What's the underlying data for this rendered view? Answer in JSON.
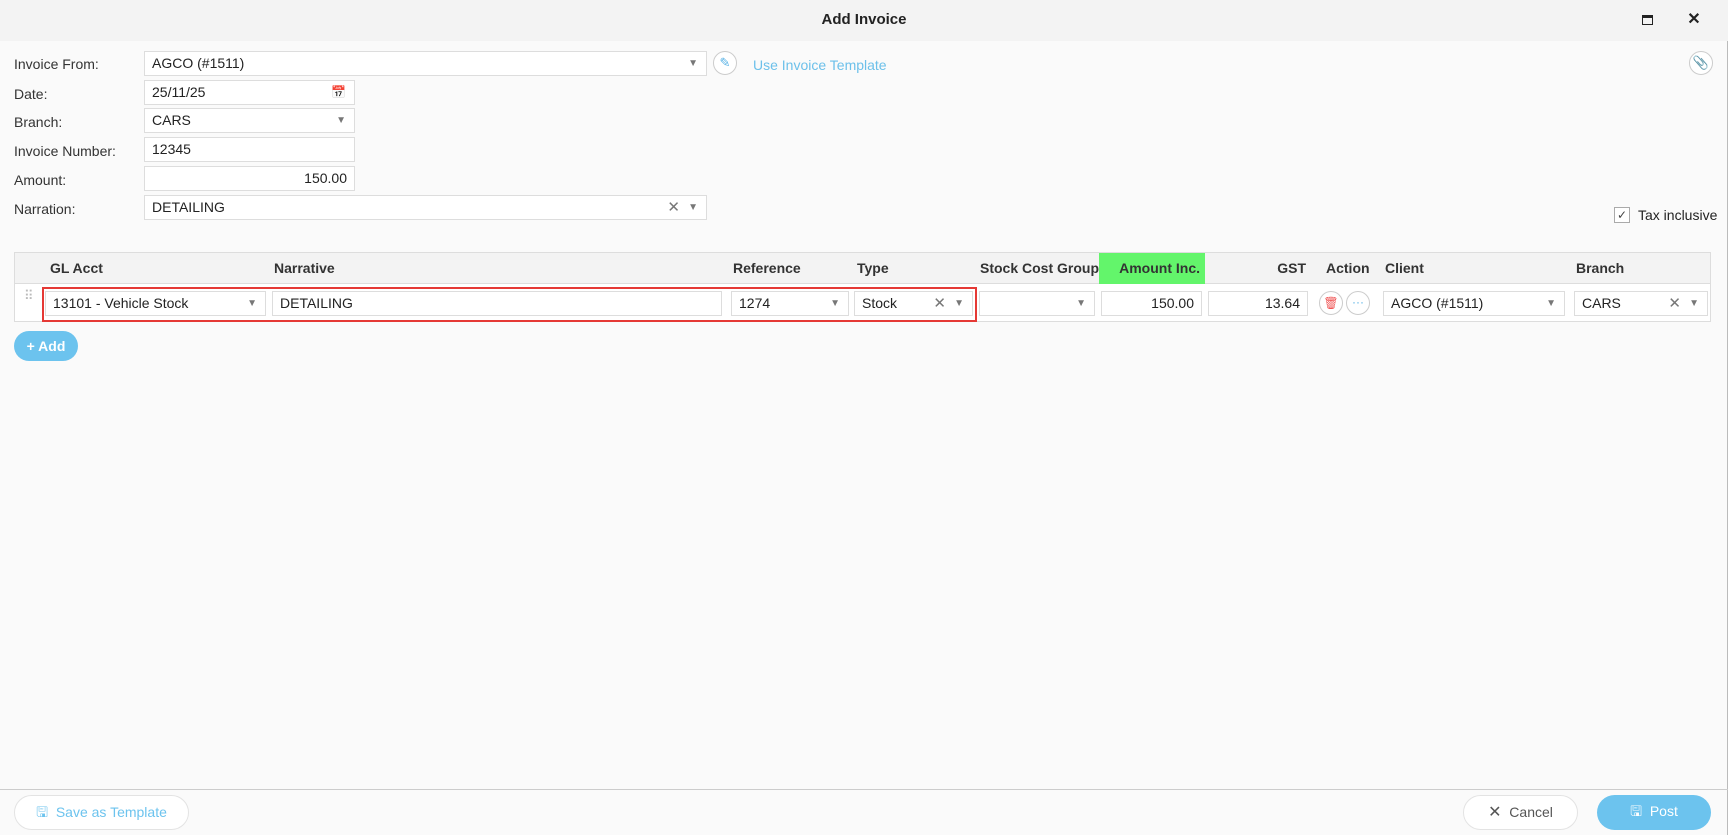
{
  "window": {
    "title": "Add Invoice",
    "maximize_icon": "maximize-icon",
    "close_icon": "close-icon"
  },
  "form": {
    "invoice_from": {
      "label": "Invoice From:",
      "value": "AGCO (#1511)"
    },
    "use_template_link": "Use Invoice Template",
    "date": {
      "label": "Date:",
      "value": "25/11/25"
    },
    "branch": {
      "label": "Branch:",
      "value": "CARS"
    },
    "invoice_number": {
      "label": "Invoice Number:",
      "value": "12345"
    },
    "amount": {
      "label": "Amount:",
      "value": "150.00"
    },
    "narration": {
      "label": "Narration:",
      "value": "DETAILING"
    },
    "tax_inclusive": {
      "label": "Tax inclusive",
      "checked": true
    }
  },
  "table": {
    "headers": {
      "gl_acct": "GL Acct",
      "narrative": "Narrative",
      "reference": "Reference",
      "type": "Type",
      "stock_cost_group": "Stock Cost Group",
      "amount_inc": "Amount Inc.",
      "gst": "GST",
      "action": "Action",
      "client": "Client",
      "branch": "Branch"
    },
    "highlight_color": "#63f56b",
    "rows": [
      {
        "gl_acct": "13101 - Vehicle Stock",
        "narrative": "DETAILING",
        "reference": "1274",
        "type": "Stock",
        "stock_cost_group": "",
        "amount_inc": "150.00",
        "gst": "13.64",
        "client": "AGCO (#1511)",
        "branch": "CARS"
      }
    ],
    "add_label": "+ Add"
  },
  "footer": {
    "save_template": "Save as Template",
    "cancel": "Cancel",
    "post": "Post"
  },
  "colors": {
    "accent": "#6cc3ee",
    "selection_border": "#e53935"
  }
}
